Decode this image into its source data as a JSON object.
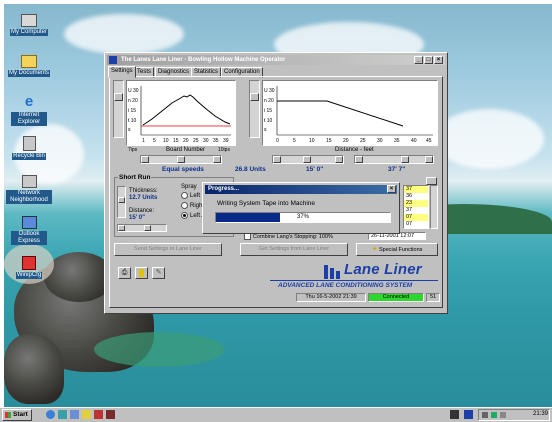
{
  "desktop_icons": [
    {
      "label": "My Computer",
      "icon": "my-computer-icon"
    },
    {
      "label": "My Documents",
      "icon": "folder-icon"
    },
    {
      "label": "Internet Explorer",
      "icon": "internet-explorer-icon"
    },
    {
      "label": "Recycle Bin",
      "icon": "recycle-bin-icon"
    },
    {
      "label": "Network Neighborhood",
      "icon": "network-icon"
    },
    {
      "label": "Outlook Express",
      "icon": "outlook-icon"
    },
    {
      "label": "WinipCfg",
      "icon": "winipcfg-icon"
    }
  ],
  "window": {
    "title": "The Lanes Lane Liner - Bowling Hollow Machine Operator",
    "tabs": [
      "Settings",
      "Tests",
      "Diagnostics",
      "Statistics",
      "Configuration"
    ],
    "active_tab": "Settings",
    "left_chart": {
      "xlabel": "Board Number",
      "left_foot": "7ips",
      "right_foot": "10ips",
      "ylabels": [
        "U 30",
        "n 20",
        "i 15",
        "t 10",
        "s"
      ],
      "x_ticks": [
        "1",
        "5",
        "10",
        "15",
        "20",
        "25",
        "30",
        "35",
        "39"
      ]
    },
    "right_chart": {
      "xlabel": "Distance - feet",
      "x_ticks": [
        "0",
        "5",
        "10",
        "15",
        "20",
        "25",
        "30",
        "35",
        "40",
        "45"
      ]
    },
    "readouts": {
      "equal_speeds": "Equal speeds",
      "units": "26.8 Units",
      "dist_a": "15' 0\"",
      "dist_b": "37' 7\""
    },
    "short_run": {
      "title": "Short Run",
      "thickness_label": "Thickness:",
      "thickness_value": "12.7 Units",
      "distance_label": "Distance:",
      "distance_value": "15' 0\"",
      "spray_label": "Spray",
      "spray_options": [
        "Left",
        "Right",
        "Left And"
      ],
      "spray_selected": "Left And"
    },
    "list_values": [
      "37",
      "36",
      "23",
      "37",
      "07",
      "07"
    ],
    "combine_label": "Combine Lang's Stopping: 100%",
    "date_value": "26-11-2001  12:07",
    "buttons": {
      "send": "Send Settings to Lane Liner",
      "get": "Get Settings from Lane Liner",
      "special": "Special Functions"
    },
    "brand_name": "Lane Liner",
    "brand_tagline": "ADVANCED LANE CONDITIONING SYSTEM",
    "status": {
      "datetime": "Thu 16-5-2002    21:39",
      "connection": "Connected",
      "number": "51"
    }
  },
  "progress_dialog": {
    "title": "Progress...",
    "message": "Writing System Tape into Machine",
    "percent_text": "37%",
    "progress": 0.37
  },
  "taskbar": {
    "start_label": "Start",
    "clock": "21:39"
  },
  "colors": {
    "progress_fill": "#0a2a8a",
    "connected_green": "#2fd62f",
    "brand_blue": "#1c3fa8"
  }
}
